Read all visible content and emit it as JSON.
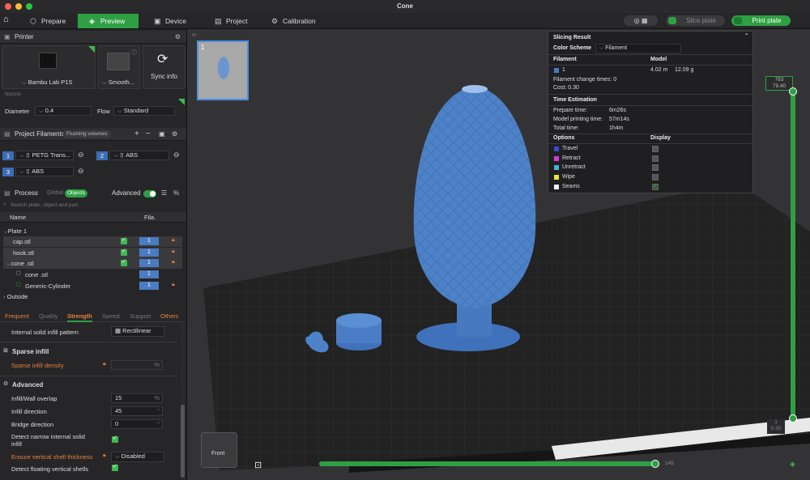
{
  "window": {
    "title": "Cone"
  },
  "toolbar": {
    "tabs": [
      {
        "label": "Prepare"
      },
      {
        "label": "Preview"
      },
      {
        "label": "Device"
      },
      {
        "label": "Project"
      },
      {
        "label": "Calibration"
      }
    ],
    "slice_label": "Slice plate",
    "print_label": "Print plate"
  },
  "printer": {
    "section": "Printer",
    "name": "Bambu Lab P1S",
    "plate": "Smooth...",
    "sync": "Sync info",
    "nozzle_label": "Nozzle",
    "diameter_label": "Diameter",
    "diameter": "0.4",
    "flow_label": "Flow",
    "flow": "Standard"
  },
  "filaments": {
    "section": "Project Filaments",
    "flushing": "Flushing volumes",
    "items": [
      {
        "index": "1",
        "name": "PETG Trans...",
        "color": "#ffffff"
      },
      {
        "index": "2",
        "name": "ABS",
        "color": "#ffffff"
      },
      {
        "index": "3",
        "name": "ABS",
        "color": "#ffffff"
      }
    ]
  },
  "process": {
    "section": "Process",
    "global": "Global",
    "objects": "Objects",
    "advanced": "Advanced",
    "search_placeholder": "Search plate, object and part.",
    "col_name": "Name",
    "col_fila": "Fila.",
    "tree": [
      {
        "name": "Plate 1"
      },
      {
        "name": "cap.stl",
        "fila": "1"
      },
      {
        "name": "hook.stl",
        "fila": "1"
      },
      {
        "name": "cone .stl",
        "fila": "1"
      },
      {
        "name": "cone .stl",
        "fila": "1"
      },
      {
        "name": "Generic-Cylinder",
        "fila": "1"
      },
      {
        "name": "Outside"
      }
    ],
    "tabs": [
      "Frequent",
      "Quality",
      "Strength",
      "Speed",
      "Support",
      "Others"
    ],
    "settings": {
      "internal_solid_infill_pattern_label": "Internal solid infill pattern",
      "internal_solid_infill_pattern": "Rectilinear",
      "sparse_infill_group": "Sparse infill",
      "sparse_infill_density_label": "Sparse infill density",
      "sparse_infill_density_unit": "%",
      "advanced_group": "Advanced",
      "infill_wall_overlap_label": "Infill/Wall overlap",
      "infill_wall_overlap": "15",
      "infill_wall_overlap_unit": "%",
      "infill_direction_label": "Infill direction",
      "infill_direction": "45",
      "infill_direction_unit": "°",
      "bridge_direction_label": "Bridge direction",
      "bridge_direction": "0",
      "bridge_direction_unit": "°",
      "detect_narrow_label_1": "Detect narrow internal solid",
      "detect_narrow_label_2": "infill",
      "ensure_vertical_label": "Ensure vertical shell thickness",
      "ensure_vertical": "Disabled",
      "detect_floating_label": "Detect floating vertical shells"
    }
  },
  "slicing": {
    "title": "Slicing Result",
    "color_scheme_label": "Color Scheme",
    "color_scheme": "Filament",
    "filament_col": "Filament",
    "model_col": "Model",
    "fil_index": "1",
    "fil_length": "4.02 m",
    "fil_weight": "12.09 g",
    "change_times": "Filament change times:  0",
    "cost": "Cost:  0.30",
    "time_title": "Time Estimation",
    "prepare_label": "Prepare time:",
    "prepare": "6m26s",
    "model_time_label": "Model printing time:",
    "model_time": "57m14s",
    "total_label": "Total time:",
    "total": "1h4m",
    "options_col": "Options",
    "display_col": "Display",
    "options": [
      {
        "name": "Travel",
        "color": "#3b4bd6"
      },
      {
        "name": "Retract",
        "color": "#d63bd6"
      },
      {
        "name": "Unretract",
        "color": "#3bb6d6"
      },
      {
        "name": "Wipe",
        "color": "#e6e63b"
      },
      {
        "name": "Seams",
        "color": "#eeeeee"
      }
    ]
  },
  "viewport": {
    "plate_number": "1",
    "view_label": "Front",
    "layer_top_1": "793",
    "layer_top_2": "79.40",
    "layer_bottom_1": "1",
    "layer_bottom_2": "0.30",
    "move_readout": "145"
  }
}
